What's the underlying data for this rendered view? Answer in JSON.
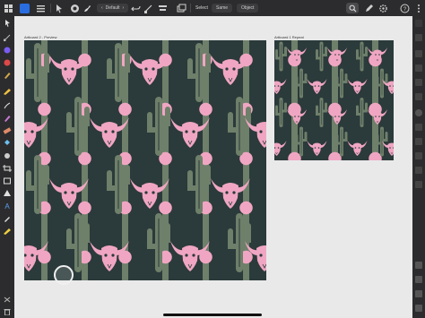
{
  "topbar": {
    "zoom_label": "Default",
    "actions": [
      "Select",
      "Same",
      "Object"
    ]
  },
  "artboards": [
    {
      "label": "Artboard 2 - Preview"
    },
    {
      "label": "Artboard 1 Repeat"
    }
  ],
  "colors": {
    "chrome": "#2c2c2e",
    "canvas": "#e9e9ea",
    "pattern_bg": "#2b3a3a",
    "skull_pink": "#f0a6c2",
    "cactus_green": "#6e7f6a"
  }
}
